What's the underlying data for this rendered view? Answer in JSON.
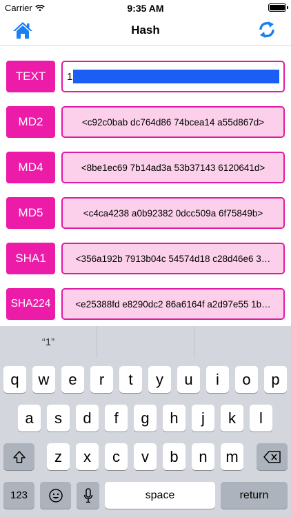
{
  "status_bar": {
    "carrier": "Carrier",
    "time": "9:35 AM"
  },
  "nav": {
    "title": "Hash",
    "accent": "#1a7ff0"
  },
  "colors": {
    "label_bg": "#ec1ca9",
    "field_bg": "#fcd0ea",
    "field_border": "#e01aa2"
  },
  "rows": [
    {
      "label": "TEXT",
      "value": "1"
    },
    {
      "label": "MD2",
      "value": "<c92c0bab dc764d86 74bcea14 a55d867d>"
    },
    {
      "label": "MD4",
      "value": "<8be1ec69 7b14ad3a 53b37143 6120641d>"
    },
    {
      "label": "MD5",
      "value": "<c4ca4238 a0b92382 0dcc509a 6f75849b>"
    },
    {
      "label": "SHA1",
      "value": "<356a192b 7913b04c 54574d18 c28d46e6 3…"
    },
    {
      "label": "SHA224",
      "value": "<e25388fd e8290dc2 86a6164f a2d97e55 1b…"
    }
  ],
  "keyboard": {
    "suggestion": "“1”",
    "row1": [
      "q",
      "w",
      "e",
      "r",
      "t",
      "y",
      "u",
      "i",
      "o",
      "p"
    ],
    "row2": [
      "a",
      "s",
      "d",
      "f",
      "g",
      "h",
      "j",
      "k",
      "l"
    ],
    "row3": [
      "z",
      "x",
      "c",
      "v",
      "b",
      "n",
      "m"
    ],
    "numbers": "123",
    "space": "space",
    "return": "return"
  }
}
